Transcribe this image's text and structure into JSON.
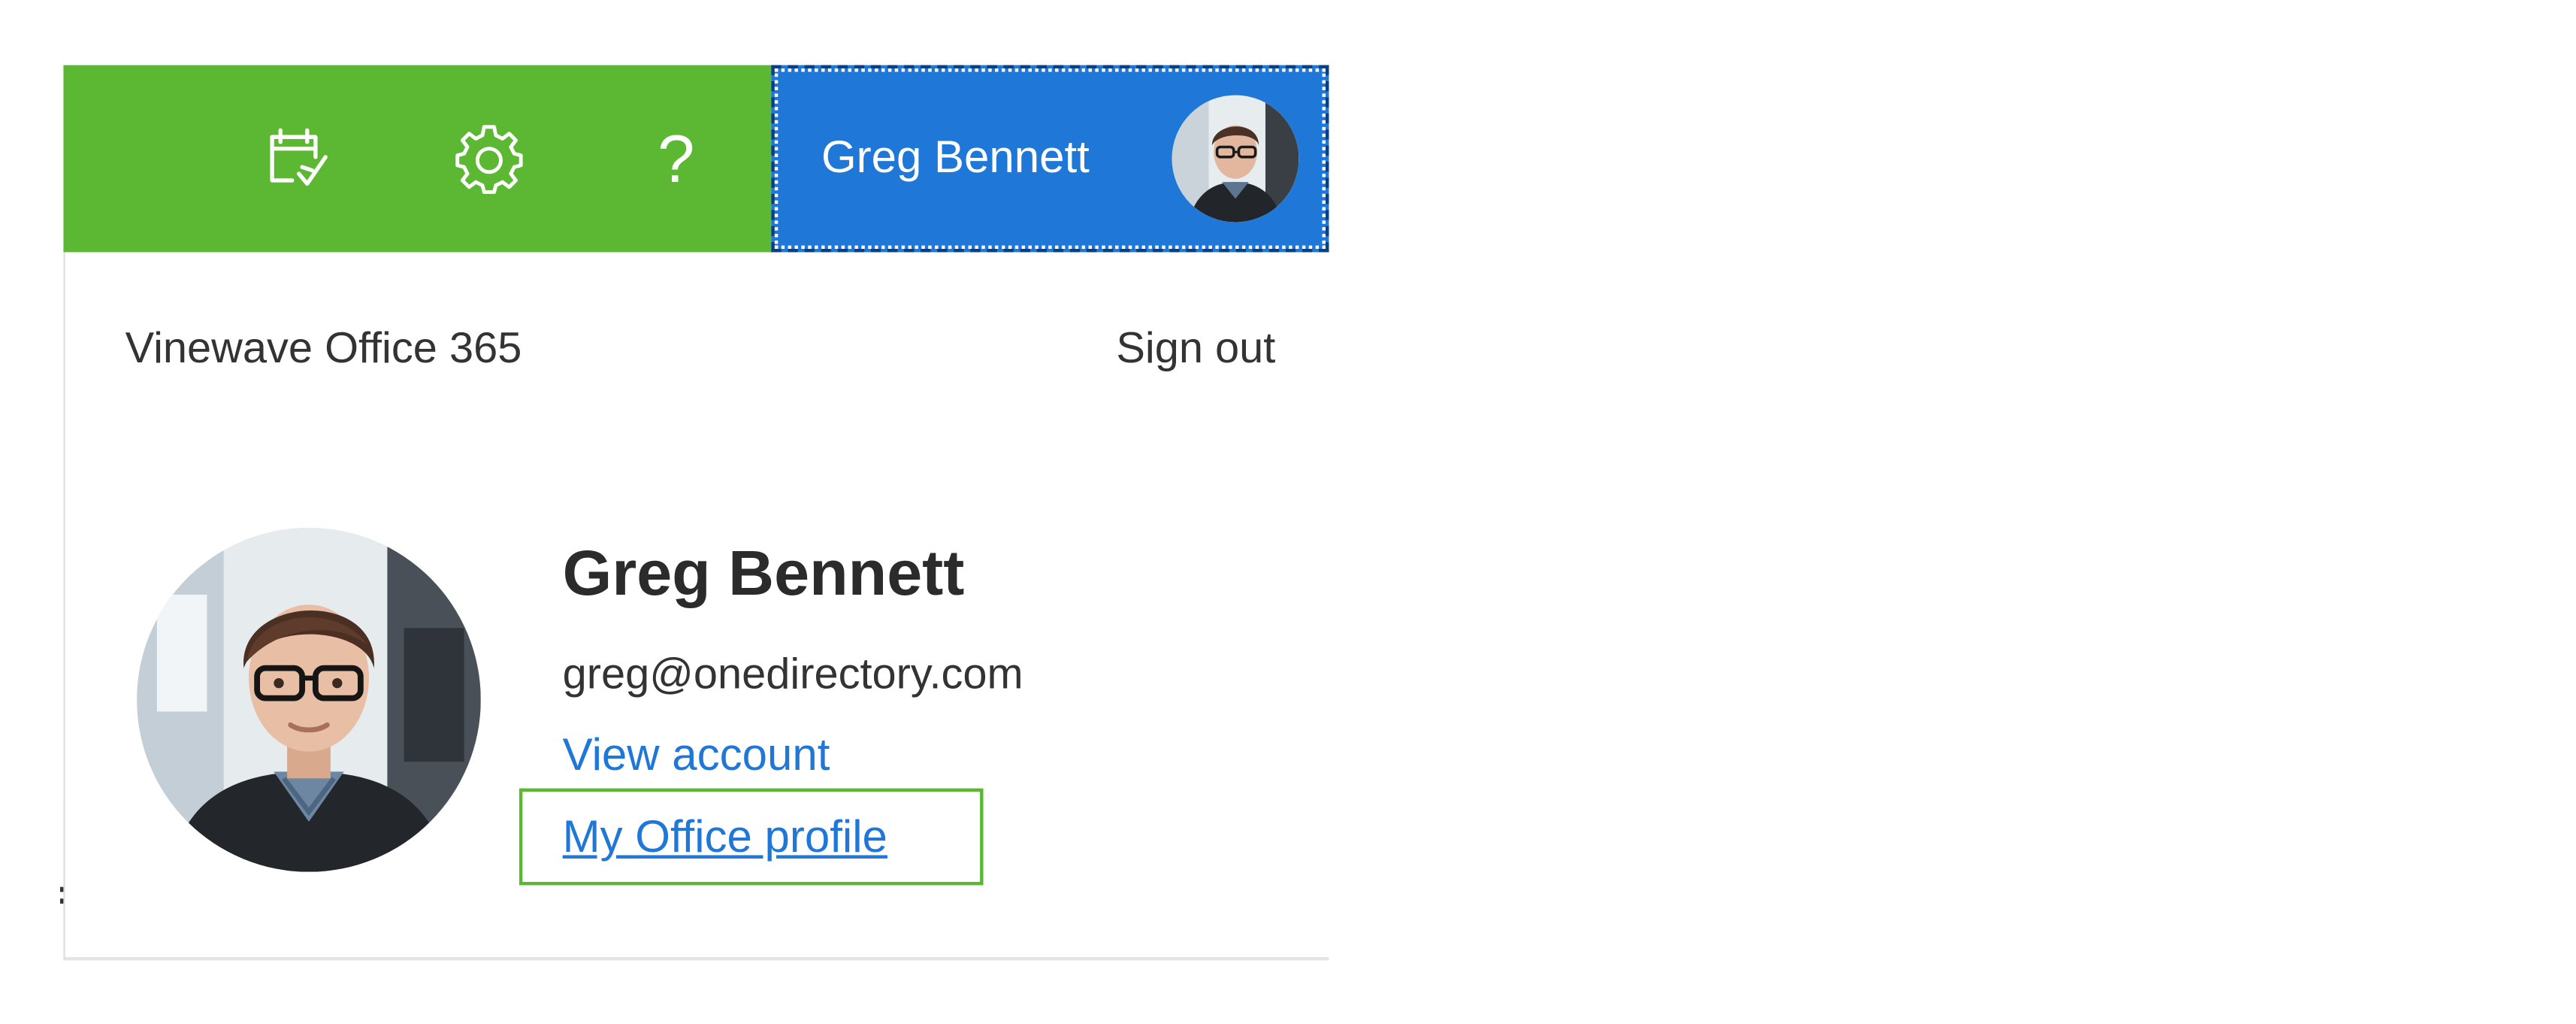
{
  "topbar": {
    "icons": [
      {
        "name": "calendar-check-icon"
      },
      {
        "name": "gear-icon"
      },
      {
        "name": "help-icon",
        "glyph": "?"
      }
    ],
    "colors": {
      "green": "#5cb833",
      "blue": "#1f78d7"
    },
    "account": {
      "name": "Greg Bennett",
      "avatar": "avatar-photo"
    }
  },
  "panel": {
    "org_name": "Vinewave Office 365",
    "sign_out": "Sign out",
    "profile": {
      "name": "Greg Bennett",
      "email": "greg@onedirectory.com",
      "view_account": "View account",
      "office_profile": "My Office profile"
    }
  }
}
